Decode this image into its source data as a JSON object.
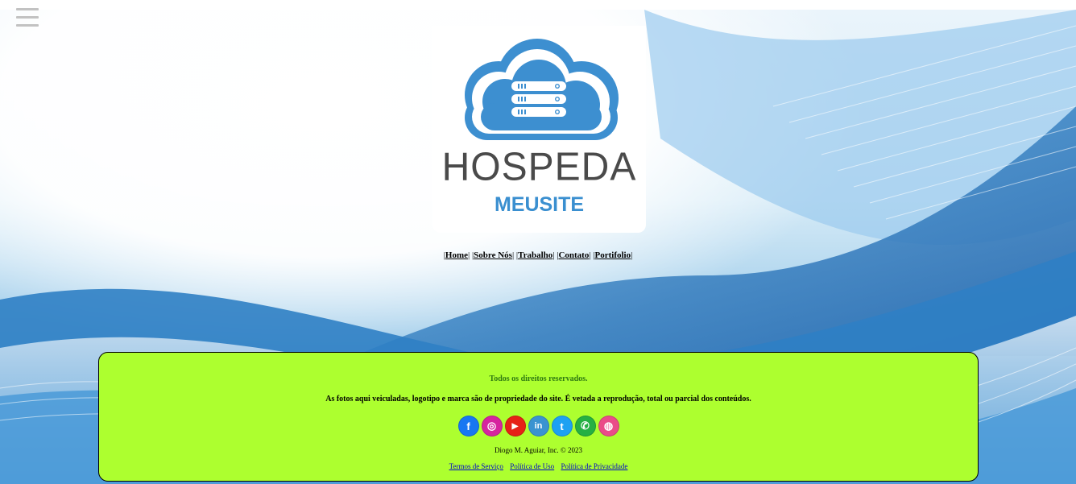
{
  "header": {
    "menu_icon": "hamburger-menu-icon",
    "logo": {
      "word_top": "HOSPEDA",
      "word_bottom": "MEUSITE",
      "icon": "cloud-server-icon"
    }
  },
  "nav": {
    "items": [
      {
        "label": "Home"
      },
      {
        "label": "Sobre Nós"
      },
      {
        "label": "Trabalho"
      },
      {
        "label": "Contato"
      },
      {
        "label": "Portifolio"
      }
    ],
    "separator": "|"
  },
  "footer": {
    "rights": "Todos os direitos reservados.",
    "notice": "As fotos aqui veiculadas, logotipo e marca são de propriedade do site. É vetada a reprodução, total ou parcial dos conteúdos.",
    "social": [
      {
        "name": "facebook-icon",
        "glyph": "f",
        "color": "#1877f2"
      },
      {
        "name": "instagram-icon",
        "glyph": "◎",
        "color": "#d6249f"
      },
      {
        "name": "youtube-icon",
        "glyph": "▶",
        "color": "#e62117"
      },
      {
        "name": "linkedin-icon",
        "glyph": "in",
        "color": "#3a93d1"
      },
      {
        "name": "twitter-icon",
        "glyph": "t",
        "color": "#1da1f2"
      },
      {
        "name": "whatsapp-icon",
        "glyph": "✆",
        "color": "#25b043"
      },
      {
        "name": "dribbble-icon",
        "glyph": "◍",
        "color": "#ea4c89"
      }
    ],
    "copyright": "Diogo M. Aguiar, Inc. © 2023",
    "links": [
      {
        "label": "Termos de Serviço"
      },
      {
        "label": "Política de Uso"
      },
      {
        "label": "Política de Privacidade"
      }
    ],
    "background_color": "#adff2f"
  }
}
